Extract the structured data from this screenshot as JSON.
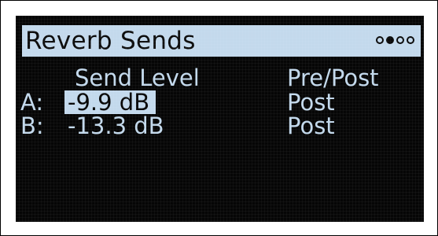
{
  "header": {
    "title": "Reverb Sends",
    "page_dots": [
      false,
      true,
      false,
      false
    ]
  },
  "columns": {
    "send_level": "Send Level",
    "pre_post": "Pre/Post"
  },
  "rows": [
    {
      "label": "A:",
      "send_level": "-9.9 dB",
      "pre_post": "Post",
      "selected": true
    },
    {
      "label": "B:",
      "send_level": "-13.3 dB",
      "pre_post": "Post",
      "selected": false
    }
  ],
  "colors": {
    "lcd_foreground": "#c3d9ec",
    "lcd_background": "#060606"
  }
}
